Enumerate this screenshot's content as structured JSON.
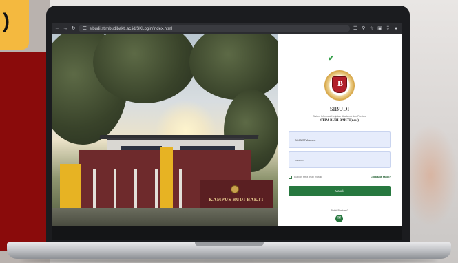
{
  "slide": {
    "corner_text": ")"
  },
  "browser": {
    "url": "sibudi.stimbudibakti.ac.id/SKLogin/index.html",
    "icons": {
      "back": "arrow-left-icon",
      "forward": "arrow-right-icon",
      "reload": "reload-icon",
      "site_info": "site-info-icon",
      "translate": "translate-icon",
      "zoom": "zoom-icon",
      "bookmark": "star-icon",
      "extensions": "puzzle-icon",
      "downloads": "download-icon",
      "profile": "profile-icon"
    }
  },
  "campus": {
    "sign_text": "KAMPUS BUDI BAKTI"
  },
  "login": {
    "app_name": "SIBUDI",
    "subtitle": "Sistem Informasi Kegiatan Akademik dan Prestasi",
    "school": "STIM BUDI BAKTI(new)",
    "username_value": "BK63/STMA••••••",
    "password_value": "•••••••••",
    "remember_label": "Biarkan saya tetap masuk",
    "forgot_label": "Lupa kata sandi?",
    "login_button": "Masuk",
    "help_text": "Butuh Bantuan?"
  },
  "colors": {
    "primary_green": "#27783f",
    "field_bg": "#e6ecfb",
    "accent_maroon": "#8a0b0b",
    "accent_yellow": "#f4b93f"
  }
}
